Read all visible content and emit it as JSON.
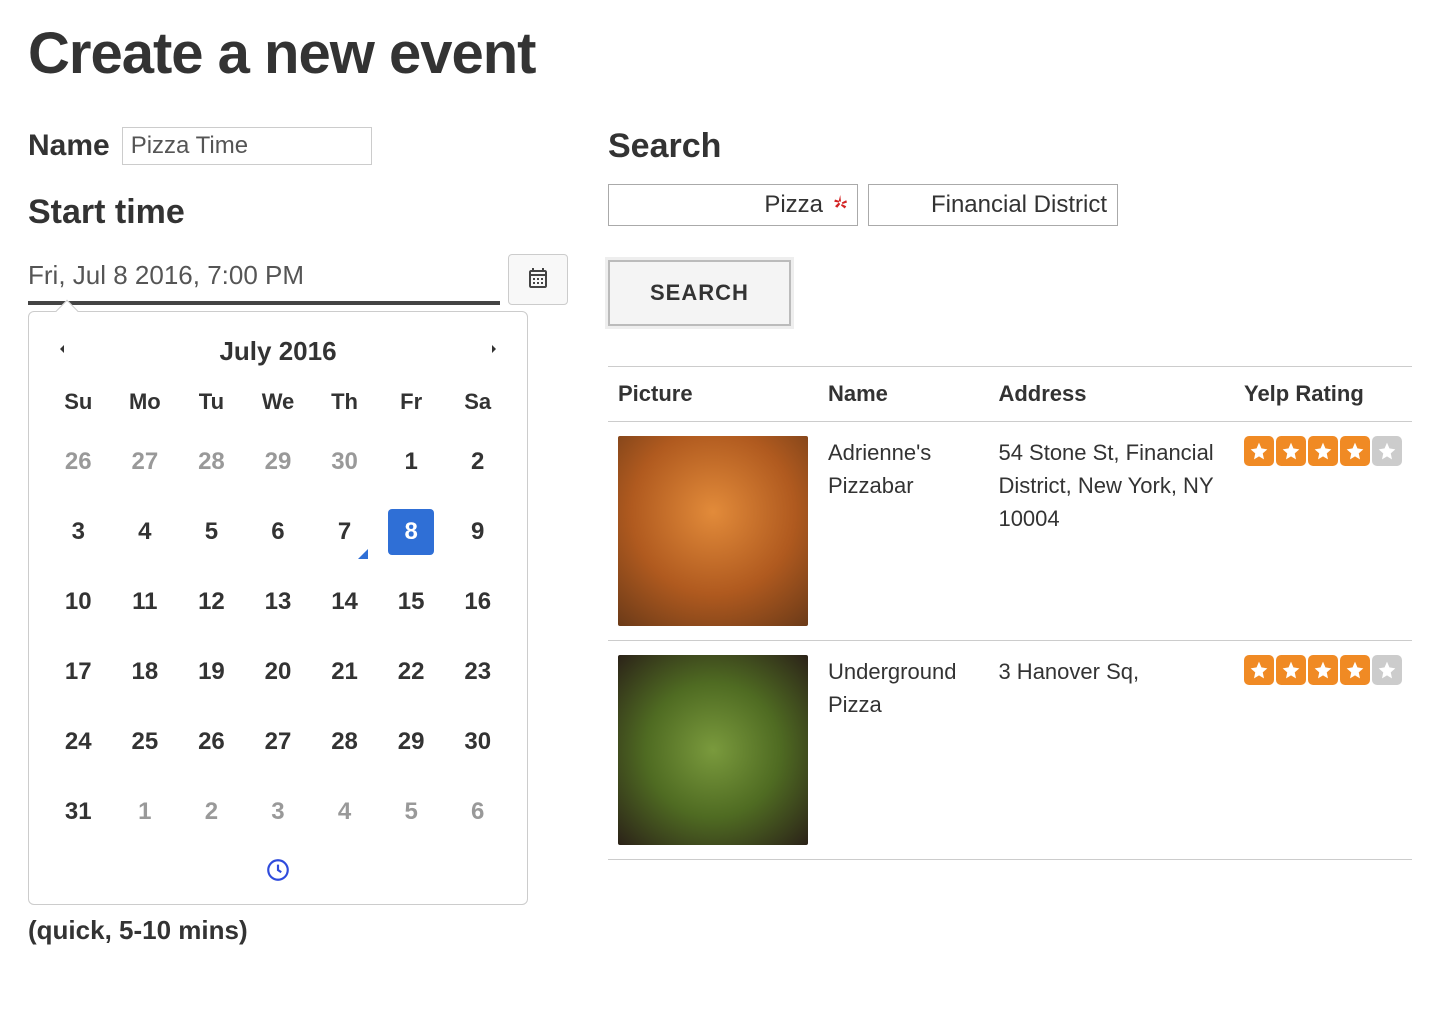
{
  "page": {
    "title": "Create a new event"
  },
  "form": {
    "name_label": "Name",
    "name_value": "Pizza Time",
    "starttime_label": "Start time",
    "starttime_value": "Fri, Jul 8 2016, 7:00 PM"
  },
  "datepicker": {
    "month_label": "July 2016",
    "dows": [
      "Su",
      "Mo",
      "Tu",
      "We",
      "Th",
      "Fr",
      "Sa"
    ],
    "weeks": [
      [
        {
          "n": "26",
          "o": true
        },
        {
          "n": "27",
          "o": true
        },
        {
          "n": "28",
          "o": true
        },
        {
          "n": "29",
          "o": true
        },
        {
          "n": "30",
          "o": true
        },
        {
          "n": "1"
        },
        {
          "n": "2"
        }
      ],
      [
        {
          "n": "3"
        },
        {
          "n": "4"
        },
        {
          "n": "5"
        },
        {
          "n": "6"
        },
        {
          "n": "7",
          "today": true
        },
        {
          "n": "8",
          "selected": true
        },
        {
          "n": "9"
        }
      ],
      [
        {
          "n": "10"
        },
        {
          "n": "11"
        },
        {
          "n": "12"
        },
        {
          "n": "13"
        },
        {
          "n": "14"
        },
        {
          "n": "15"
        },
        {
          "n": "16"
        }
      ],
      [
        {
          "n": "17"
        },
        {
          "n": "18"
        },
        {
          "n": "19"
        },
        {
          "n": "20"
        },
        {
          "n": "21"
        },
        {
          "n": "22"
        },
        {
          "n": "23"
        }
      ],
      [
        {
          "n": "24"
        },
        {
          "n": "25"
        },
        {
          "n": "26"
        },
        {
          "n": "27"
        },
        {
          "n": "28"
        },
        {
          "n": "29"
        },
        {
          "n": "30"
        }
      ],
      [
        {
          "n": "31"
        },
        {
          "n": "1",
          "o": true
        },
        {
          "n": "2",
          "o": true
        },
        {
          "n": "3",
          "o": true
        },
        {
          "n": "4",
          "o": true
        },
        {
          "n": "5",
          "o": true
        },
        {
          "n": "6",
          "o": true
        }
      ]
    ]
  },
  "search": {
    "heading": "Search",
    "term": "Pizza",
    "location": "Financial District",
    "button_label": "SEARCH"
  },
  "results": {
    "headers": {
      "picture": "Picture",
      "name": "Name",
      "address": "Address",
      "rating": "Yelp Rating"
    },
    "rows": [
      {
        "name": "Adrienne's Pizzabar",
        "address": "54 Stone St, Financial District, New York, NY 10004",
        "rating": 4,
        "thumb_class": "beer"
      },
      {
        "name": "Underground Pizza",
        "address": "3 Hanover Sq,",
        "rating": 4,
        "thumb_class": "pizza"
      }
    ]
  },
  "truncated_hint": "(quick, 5-10 mins)"
}
